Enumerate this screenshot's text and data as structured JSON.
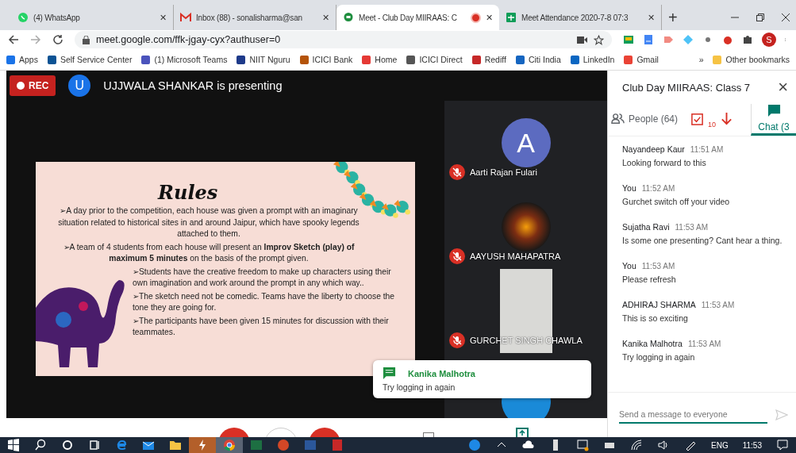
{
  "browser": {
    "tabs": [
      {
        "title": "(4) WhatsApp",
        "kind": "whatsapp",
        "selected": false,
        "close": "✕"
      },
      {
        "title": "Inbox (88) - sonalisharma@san",
        "kind": "gmail",
        "selected": false,
        "close": "✕"
      },
      {
        "title": "Meet - Club Day MIIRAAS: C",
        "kind": "meet",
        "selected": true,
        "close": "✕"
      },
      {
        "title": "Meet Attendance 2020-7-8 07:3",
        "kind": "sheets",
        "selected": false,
        "close": "✕"
      }
    ],
    "new_tab": "+",
    "address": "meet.google.com/ffk-jgay-cyx?authuser=0",
    "profile_initial": "S",
    "bookmarks": [
      "Apps",
      "Self Service Center",
      "(1) Microsoft Teams",
      "NIIT Nguru",
      "ICICI Bank",
      "Home",
      "ICICI Direct",
      "Rediff",
      "Citi India",
      "LinkedIn",
      "Gmail"
    ],
    "bookmarks_overflow": "»",
    "other_bookmarks": "Other bookmarks"
  },
  "meeting": {
    "recording_label": "REC",
    "presenter_initial": "U",
    "presenter_banner": "UJJWALA SHANKAR is presenting",
    "slide": {
      "title": "Rules",
      "bullets": [
        {
          "kind": "centered",
          "text": "➢A day prior to the competition, each house was given a prompt with an imaginary situation related to historical sites in and around Jaipur, which have spooky legends attached to them."
        },
        {
          "kind": "centered",
          "text": "➢A team of 4 students from each house will present an **Improv Sketch (play) of maximum 5 minutes** on the basis of the prompt given."
        },
        {
          "kind": "indented",
          "text": "➢Students have the creative freedom to make up characters using their own imagination and work around the prompt in any which way.."
        },
        {
          "kind": "indented",
          "text": "➢The sketch need not be comedic. Teams have the liberty to choose the tone they are going for."
        },
        {
          "kind": "indented",
          "text": "➢The participants have been given 15 minutes for discussion with their teammates."
        }
      ]
    },
    "participants": [
      {
        "kind": "avatar",
        "initial": "A",
        "name": "Aarti Rajan Fulari",
        "muted": true
      },
      {
        "kind": "photo",
        "name": "AAYUSH MAHAPATRA",
        "muted": true
      },
      {
        "kind": "video",
        "name": "GURCHET SINGH CHAWLA",
        "muted": true
      },
      {
        "kind": "partial"
      }
    ],
    "toast": {
      "sender": "Kanika Malhotra",
      "message": "Try logging in again"
    }
  },
  "chat_panel": {
    "title": "Club Day MIIRAAS: Class 7",
    "close": "×",
    "tabs": [
      {
        "kind": "people",
        "label": "People (64)",
        "selected": false
      },
      {
        "kind": "tasks",
        "label": "10",
        "selected": false
      },
      {
        "kind": "chat",
        "label": "Chat (3",
        "selected": true
      }
    ],
    "messages": [
      {
        "sender": "Nayandeep Kaur",
        "time": "11:51 AM",
        "text": "Looking forward to this"
      },
      {
        "sender": "You",
        "time": "11:52 AM",
        "text": "Gurchet switch off your video"
      },
      {
        "sender": "Sujatha Ravi",
        "time": "11:53 AM",
        "text": "Is  some one presenting? Cant hear a thing."
      },
      {
        "sender": "You",
        "time": "11:53 AM",
        "text": "Please refresh"
      },
      {
        "sender": "ADHIRAJ SHARMA",
        "time": "11:53 AM",
        "text": "This is so exciting"
      },
      {
        "sender": "Kanika Malhotra",
        "time": "11:53 AM",
        "text": "Try logging in again"
      }
    ],
    "input_placeholder": "Send a message to everyone"
  },
  "taskbar": {
    "language": "ENG",
    "time": "11:53"
  }
}
